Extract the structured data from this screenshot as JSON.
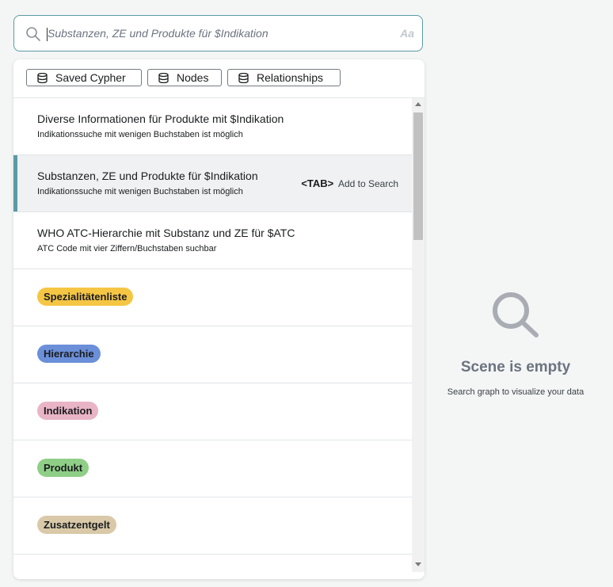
{
  "search": {
    "placeholder": "Substanzen, ZE und Produkte für $Indikation",
    "case_toggle": "Aa",
    "icon": "search-icon"
  },
  "filters": [
    {
      "label": "Saved Cypher",
      "icon": "database-icon"
    },
    {
      "label": "Nodes",
      "icon": "database-icon"
    },
    {
      "label": "Relationships",
      "icon": "database-icon"
    }
  ],
  "suggestions": [
    {
      "title": "Diverse Informationen für Produkte mit $Indikation",
      "subtitle": "Indikationssuche mit wenigen Buchstaben ist möglich"
    },
    {
      "title": "Substanzen, ZE und Produkte für $Indikation",
      "subtitle": "Indikationssuche mit wenigen Buchstaben ist möglich",
      "tab_key": "<TAB>",
      "tab_action": "Add to Search"
    },
    {
      "title": "WHO ATC-Hierarchie mit Substanz und ZE für $ATC",
      "subtitle": "ATC Code mit vier Ziffern/Buchstaben suchbar"
    }
  ],
  "node_labels": [
    {
      "label": "Spezialitätenliste",
      "color": "#f5c644"
    },
    {
      "label": "Hierarchie",
      "color": "#6b8fd9"
    },
    {
      "label": "Indikation",
      "color": "#e9b4c6"
    },
    {
      "label": "Produkt",
      "color": "#8fce86"
    },
    {
      "label": "Zusatzentgelt",
      "color": "#d9c9a8"
    }
  ],
  "empty_state": {
    "title": "Scene is empty",
    "subtitle": "Search graph to visualize your data",
    "icon": "search-icon"
  },
  "colors": {
    "accent": "#5a9ba6",
    "selected_row": "#f0f1f2"
  }
}
